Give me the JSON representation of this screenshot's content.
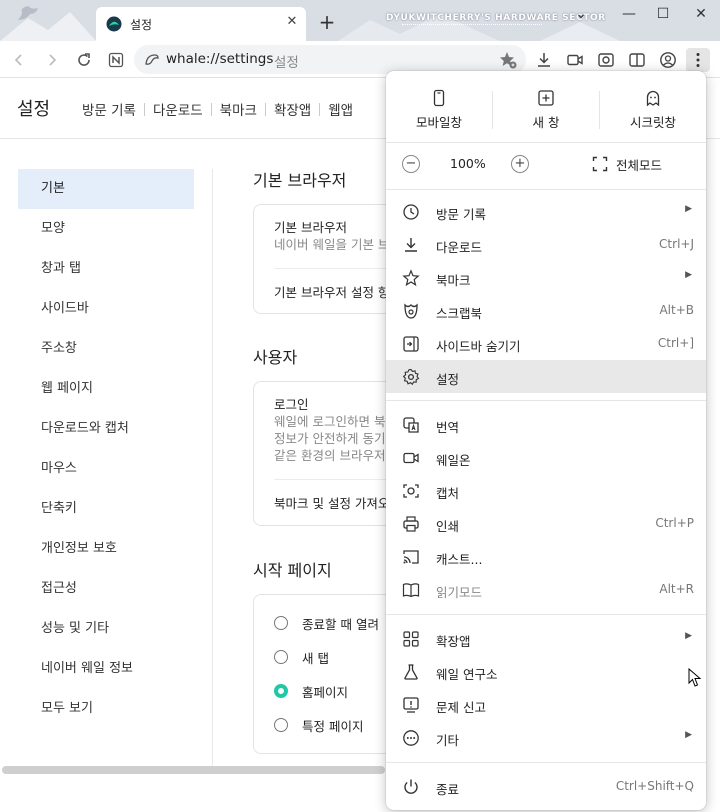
{
  "browser": {
    "tab_title": "설정",
    "watermark": "DYUKWITCHERRY'S HARDWARE SECTOR",
    "url": "whale://settings",
    "url_title": "설정"
  },
  "settings": {
    "title": "설정",
    "top_nav": [
      "방문 기록",
      "다운로드",
      "북마크",
      "확장앱",
      "웹앱"
    ],
    "left_nav": [
      "기본",
      "모양",
      "창과 탭",
      "사이드바",
      "주소창",
      "웹 페이지",
      "다운로드와 캡처",
      "마우스",
      "단축키",
      "개인정보 보호",
      "접근성",
      "성능 및 기타",
      "네이버 웨일 정보",
      "모두 보기"
    ],
    "sections": {
      "default_browser": {
        "title": "기본 브라우저",
        "row_title": "기본 브라우저",
        "row_desc": "네이버 웨일을 기본 브",
        "row_link": "기본 브라우저 설정 항"
      },
      "user": {
        "title": "사용자",
        "row_title": "로그인",
        "desc_lines": [
          "웨일에 로그인하면 북",
          "정보가 안전하게 동기",
          "같은 환경의 브라우저"
        ],
        "row_link": "북마크 및 설정 가져오"
      },
      "start_page": {
        "title": "시작 페이지",
        "options": [
          "종료할 때 열려",
          "새 탭",
          "홈페이지",
          "특정 페이지"
        ],
        "selected_index": 2
      }
    }
  },
  "menu": {
    "quick": [
      "모바일창",
      "새 창",
      "시크릿창"
    ],
    "zoom": {
      "value": "100%",
      "minus": "−",
      "plus": "+",
      "fullscreen": "전체모드"
    },
    "items": [
      {
        "label": "방문 기록",
        "shortcut": "",
        "submenu": true,
        "icon": "history-icon"
      },
      {
        "label": "다운로드",
        "shortcut": "Ctrl+J",
        "submenu": false,
        "icon": "download-icon"
      },
      {
        "label": "북마크",
        "shortcut": "",
        "submenu": true,
        "icon": "star-icon"
      },
      {
        "label": "스크랩북",
        "shortcut": "Alt+B",
        "submenu": false,
        "icon": "scrapbook-icon"
      },
      {
        "label": "사이드바 숨기기",
        "shortcut": "Ctrl+]",
        "submenu": false,
        "icon": "sidebar-icon"
      },
      {
        "label": "설정",
        "shortcut": "",
        "submenu": false,
        "icon": "gear-icon"
      },
      {
        "label": "번역",
        "shortcut": "",
        "submenu": false,
        "icon": "translate-icon"
      },
      {
        "label": "웨일온",
        "shortcut": "",
        "submenu": false,
        "icon": "video-icon"
      },
      {
        "label": "캡처",
        "shortcut": "",
        "submenu": false,
        "icon": "capture-icon"
      },
      {
        "label": "인쇄",
        "shortcut": "Ctrl+P",
        "submenu": false,
        "icon": "print-icon"
      },
      {
        "label": "캐스트...",
        "shortcut": "",
        "submenu": false,
        "icon": "cast-icon"
      },
      {
        "label": "읽기모드",
        "shortcut": "Alt+R",
        "submenu": false,
        "icon": "reader-icon",
        "disabled": true
      },
      {
        "label": "확장앱",
        "shortcut": "",
        "submenu": true,
        "icon": "extensions-icon"
      },
      {
        "label": "웨일 연구소",
        "shortcut": "",
        "submenu": false,
        "icon": "flask-icon"
      },
      {
        "label": "문제 신고",
        "shortcut": "",
        "submenu": false,
        "icon": "report-icon"
      },
      {
        "label": "기타",
        "shortcut": "",
        "submenu": true,
        "icon": "more-icon"
      },
      {
        "label": "종료",
        "shortcut": "Ctrl+Shift+Q",
        "submenu": false,
        "icon": "power-icon"
      }
    ],
    "highlighted_index": 5
  },
  "colors": {
    "accent": "#1fc9a6",
    "nav_active_bg": "#e4eefb",
    "menu_highlight": "#e8e8e8"
  }
}
